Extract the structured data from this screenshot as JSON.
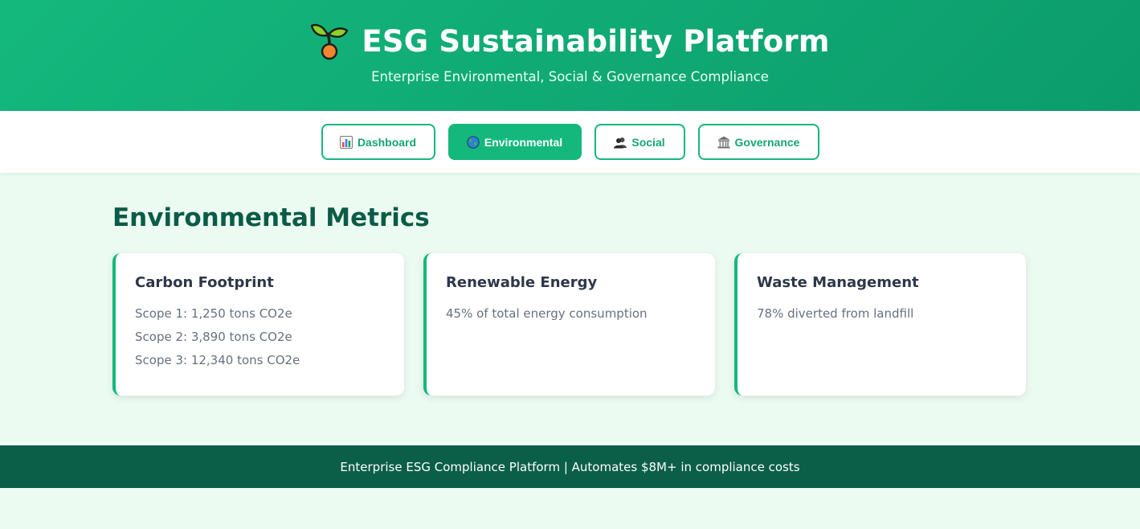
{
  "header": {
    "logo_icon": "seedling-icon",
    "title": "ESG Sustainability Platform",
    "subtitle": "Enterprise Environmental, Social & Governance Compliance"
  },
  "nav": {
    "tabs": [
      {
        "label": "Dashboard",
        "icon": "bar-chart-icon",
        "active": false
      },
      {
        "label": "Environmental",
        "icon": "globe-icon",
        "active": true
      },
      {
        "label": "Social",
        "icon": "people-icon",
        "active": false
      },
      {
        "label": "Governance",
        "icon": "bank-icon",
        "active": false
      }
    ]
  },
  "main": {
    "section_title": "Environmental Metrics",
    "cards": [
      {
        "title": "Carbon Footprint",
        "lines": [
          "Scope 1: 1,250 tons CO2e",
          "Scope 2: 3,890 tons CO2e",
          "Scope 3: 12,340 tons CO2e"
        ]
      },
      {
        "title": "Renewable Energy",
        "lines": [
          "45% of total energy consumption"
        ]
      },
      {
        "title": "Waste Management",
        "lines": [
          "78% diverted from landfill"
        ]
      }
    ]
  },
  "footer": {
    "text": "Enterprise ESG Compliance Platform | Automates $8M+ in compliance costs"
  },
  "colors": {
    "brand": "#14b87d",
    "brand_dark": "#0b5e47",
    "page_background": "#ecfbf2",
    "card_text": "#66717f"
  }
}
